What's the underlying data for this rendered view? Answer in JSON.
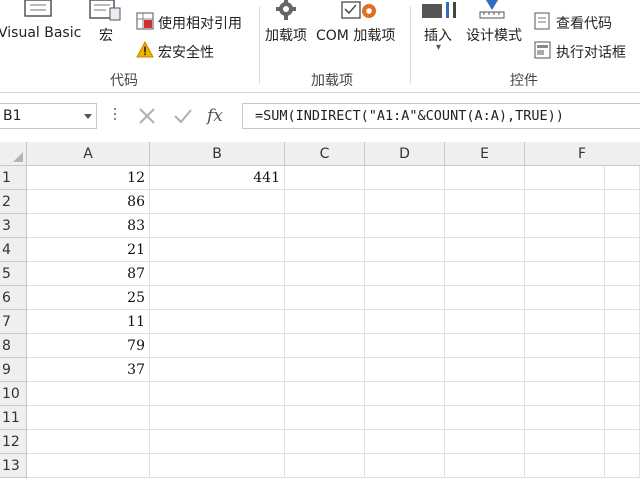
{
  "ribbon": {
    "code_group": {
      "visual_basic": "Visual Basic",
      "macros": "宏",
      "relative_ref": "使用相对引用",
      "macro_security": "宏安全性",
      "label": "代码"
    },
    "addins_group": {
      "addins": "加载项",
      "com_addins": "COM 加载项",
      "label": "加载项"
    },
    "controls_group": {
      "insert": "插入",
      "design_mode": "设计模式",
      "view_code": "查看代码",
      "run_dialog": "执行对话框",
      "label": "控件"
    }
  },
  "formula_bar": {
    "name_box": "B1",
    "fx": "fx",
    "formula": "=SUM(INDIRECT(\"A1:A\"&COUNT(A:A),TRUE))"
  },
  "sheet": {
    "columns": [
      "A",
      "B",
      "C",
      "D",
      "E",
      "F"
    ],
    "rows": [
      "1",
      "2",
      "3",
      "4",
      "5",
      "6",
      "7",
      "8",
      "9",
      "10",
      "11",
      "12",
      "13"
    ],
    "col_a": [
      "12",
      "86",
      "83",
      "21",
      "87",
      "25",
      "11",
      "79",
      "37",
      "",
      "",
      "",
      ""
    ],
    "col_b": [
      "441",
      "",
      "",
      "",
      "",
      "",
      "",
      "",
      "",
      "",
      "",
      "",
      ""
    ]
  },
  "colors": {
    "header_bg": "#efefef",
    "grid_line": "#e1e1e1",
    "warning": "#f2b100",
    "addin_gear": "#e07020"
  }
}
